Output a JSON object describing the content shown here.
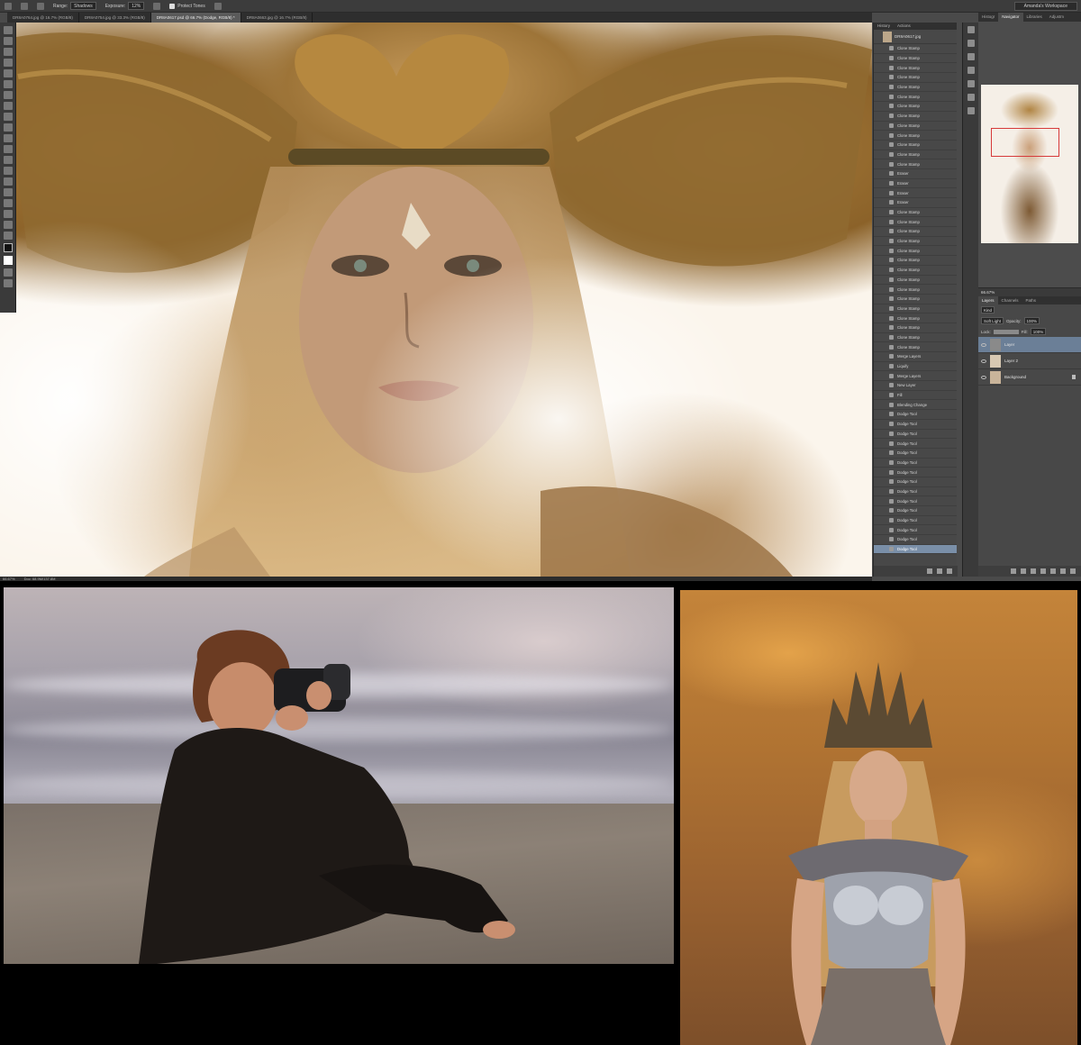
{
  "options_bar": {
    "range_label": "Range:",
    "range_value": "Shadows",
    "exposure_label": "Exposure:",
    "exposure_value": "12%",
    "protect_tones": "Protect Tones",
    "workspace": "Amanda's Workspace"
  },
  "document_tabs": [
    {
      "label": "DR8A0764.jpg @ 16.7% (RGB/8)",
      "active": false
    },
    {
      "label": "DR8A0754.jpg @ 33.3% (RGB/8)",
      "active": false
    },
    {
      "label": "DR8A0617.psd @ 66.7% (Dodge, RGB/8) *",
      "active": true
    },
    {
      "label": "DR8A0663.jpg @ 16.7% (RGB/8)",
      "active": false
    }
  ],
  "history": {
    "tabs": [
      "History",
      "Actions"
    ],
    "snapshot": "DR8A0617.jpg",
    "items": [
      "Clone Stamp",
      "Clone Stamp",
      "Clone Stamp",
      "Clone Stamp",
      "Clone Stamp",
      "Clone Stamp",
      "Clone Stamp",
      "Clone Stamp",
      "Clone Stamp",
      "Clone Stamp",
      "Clone Stamp",
      "Clone Stamp",
      "Clone Stamp",
      "Eraser",
      "Eraser",
      "Eraser",
      "Eraser",
      "Clone Stamp",
      "Clone Stamp",
      "Clone Stamp",
      "Clone Stamp",
      "Clone Stamp",
      "Clone Stamp",
      "Clone Stamp",
      "Clone Stamp",
      "Clone Stamp",
      "Clone Stamp",
      "Clone Stamp",
      "Clone Stamp",
      "Clone Stamp",
      "Clone Stamp",
      "Clone Stamp",
      "Merge Layers",
      "Liquify",
      "Merge Layers",
      "New Layer",
      "Fill",
      "Blending Change",
      "Dodge Tool",
      "Dodge Tool",
      "Dodge Tool",
      "Dodge Tool",
      "Dodge Tool",
      "Dodge Tool",
      "Dodge Tool",
      "Dodge Tool",
      "Dodge Tool",
      "Dodge Tool",
      "Dodge Tool",
      "Dodge Tool",
      "Dodge Tool",
      "Dodge Tool",
      "Dodge Tool"
    ]
  },
  "navigator": {
    "tabs": [
      "Histogr",
      "Navigator",
      "Libraries",
      "Adjustm"
    ]
  },
  "layers": {
    "zoom": "66.67%",
    "tabs": [
      "Layers",
      "Channels",
      "Paths"
    ],
    "kind": "Kind",
    "blend_mode": "Soft Light",
    "opacity_label": "Opacity:",
    "opacity_value": "100%",
    "lock_label": "Lock:",
    "fill_label": "Fill:",
    "fill_value": "100%",
    "items": [
      {
        "name": "Layer",
        "selected": true
      },
      {
        "name": "Layer 2",
        "selected": false
      },
      {
        "name": "Background",
        "selected": false
      }
    ]
  },
  "status_bar": {
    "zoom": "66.67%",
    "doc": "Doc: 68.9M/137.8M"
  }
}
